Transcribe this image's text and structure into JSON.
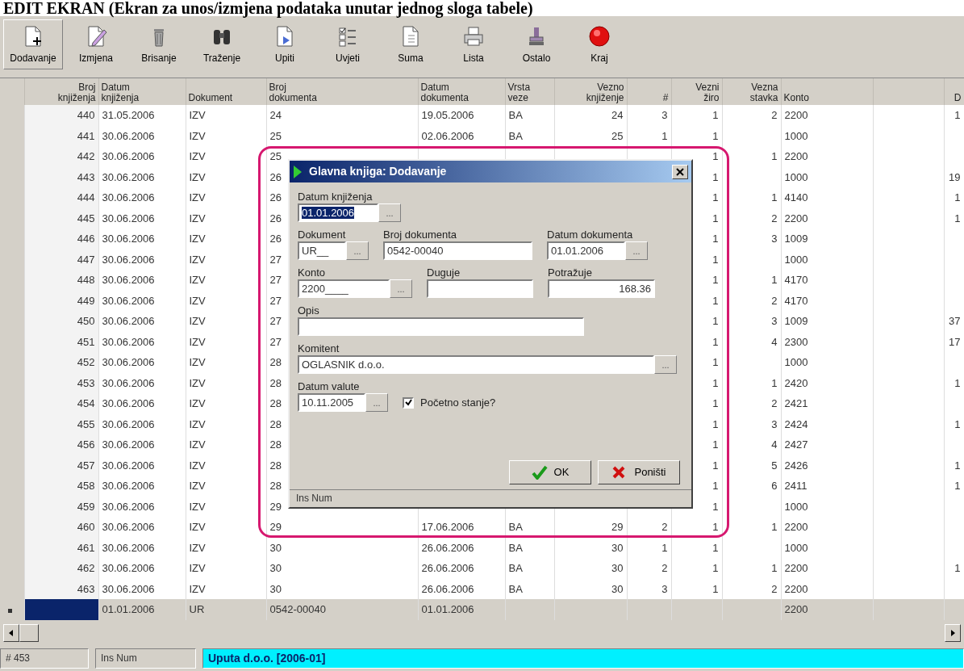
{
  "heading": "EDIT EKRAN (Ekran za unos/izmjena podataka unutar jednog sloga tabele)",
  "toolbar": [
    {
      "label": "Dodavanje",
      "selected": true
    },
    {
      "label": "Izmjena",
      "selected": false
    },
    {
      "label": "Brisanje",
      "selected": false
    },
    {
      "label": "Traženje",
      "selected": false
    },
    {
      "label": "Upiti",
      "selected": false
    },
    {
      "label": "Uvjeti",
      "selected": false
    },
    {
      "label": "Suma",
      "selected": false
    },
    {
      "label": "Lista",
      "selected": false
    },
    {
      "label": "Ostalo",
      "selected": false
    },
    {
      "label": "Kraj",
      "selected": false
    }
  ],
  "grid": {
    "columns": [
      "Broj knjiženja",
      "Datum knjiženja",
      "Dokument",
      "Broj dokumenta",
      "Datum dokumenta",
      "Vrsta veze",
      "Vezno knjiženje",
      "#",
      "Vezni žiro",
      "Vezna stavka",
      "Konto",
      "D"
    ],
    "rows": [
      {
        "selected": false,
        "cells": [
          "440",
          "31.05.2006",
          "IZV",
          "24",
          "19.05.2006",
          "BA",
          "24",
          "3",
          "1",
          "2",
          "2200",
          "1"
        ]
      },
      {
        "selected": false,
        "cells": [
          "441",
          "30.06.2006",
          "IZV",
          "25",
          "02.06.2006",
          "BA",
          "25",
          "1",
          "1",
          null,
          "1000",
          null
        ]
      },
      {
        "selected": false,
        "cells": [
          "442",
          "30.06.2006",
          "IZV",
          "25",
          null,
          null,
          null,
          null,
          "1",
          "1",
          "2200",
          null
        ]
      },
      {
        "selected": false,
        "cells": [
          "443",
          "30.06.2006",
          "IZV",
          "26",
          null,
          null,
          null,
          null,
          "1",
          null,
          "1000",
          "19"
        ]
      },
      {
        "selected": false,
        "cells": [
          "444",
          "30.06.2006",
          "IZV",
          "26",
          null,
          null,
          null,
          null,
          "1",
          "1",
          "4140",
          "1"
        ]
      },
      {
        "selected": false,
        "cells": [
          "445",
          "30.06.2006",
          "IZV",
          "26",
          null,
          null,
          null,
          null,
          "1",
          "2",
          "2200",
          "1"
        ]
      },
      {
        "selected": false,
        "cells": [
          "446",
          "30.06.2006",
          "IZV",
          "26",
          null,
          null,
          null,
          null,
          "1",
          "3",
          "1009",
          null
        ]
      },
      {
        "selected": false,
        "cells": [
          "447",
          "30.06.2006",
          "IZV",
          "27",
          null,
          null,
          null,
          null,
          "1",
          null,
          "1000",
          null
        ]
      },
      {
        "selected": false,
        "cells": [
          "448",
          "30.06.2006",
          "IZV",
          "27",
          null,
          null,
          null,
          null,
          "1",
          "1",
          "4170",
          null
        ]
      },
      {
        "selected": false,
        "cells": [
          "449",
          "30.06.2006",
          "IZV",
          "27",
          null,
          null,
          null,
          null,
          "1",
          "2",
          "4170",
          null
        ]
      },
      {
        "selected": false,
        "cells": [
          "450",
          "30.06.2006",
          "IZV",
          "27",
          null,
          null,
          null,
          null,
          "1",
          "3",
          "1009",
          "37"
        ]
      },
      {
        "selected": false,
        "cells": [
          "451",
          "30.06.2006",
          "IZV",
          "27",
          null,
          null,
          null,
          null,
          "1",
          "4",
          "2300",
          "17"
        ]
      },
      {
        "selected": false,
        "cells": [
          "452",
          "30.06.2006",
          "IZV",
          "28",
          null,
          null,
          null,
          null,
          "1",
          null,
          "1000",
          null
        ]
      },
      {
        "selected": false,
        "cells": [
          "453",
          "30.06.2006",
          "IZV",
          "28",
          null,
          null,
          null,
          null,
          "1",
          "1",
          "2420",
          "1"
        ]
      },
      {
        "selected": false,
        "cells": [
          "454",
          "30.06.2006",
          "IZV",
          "28",
          null,
          null,
          null,
          null,
          "1",
          "2",
          "2421",
          null
        ]
      },
      {
        "selected": false,
        "cells": [
          "455",
          "30.06.2006",
          "IZV",
          "28",
          null,
          null,
          null,
          null,
          "1",
          "3",
          "2424",
          "1"
        ]
      },
      {
        "selected": false,
        "cells": [
          "456",
          "30.06.2006",
          "IZV",
          "28",
          null,
          null,
          null,
          null,
          "1",
          "4",
          "2427",
          null
        ]
      },
      {
        "selected": false,
        "cells": [
          "457",
          "30.06.2006",
          "IZV",
          "28",
          null,
          null,
          null,
          null,
          "1",
          "5",
          "2426",
          "1"
        ]
      },
      {
        "selected": false,
        "cells": [
          "458",
          "30.06.2006",
          "IZV",
          "28",
          null,
          null,
          null,
          null,
          "1",
          "6",
          "2411",
          "1"
        ]
      },
      {
        "selected": false,
        "cells": [
          "459",
          "30.06.2006",
          "IZV",
          "29",
          null,
          null,
          null,
          null,
          "1",
          null,
          "1000",
          null
        ]
      },
      {
        "selected": false,
        "cells": [
          "460",
          "30.06.2006",
          "IZV",
          "29",
          "17.06.2006",
          "BA",
          "29",
          "2",
          "1",
          "1",
          "2200",
          null
        ]
      },
      {
        "selected": false,
        "cells": [
          "461",
          "30.06.2006",
          "IZV",
          "30",
          "26.06.2006",
          "BA",
          "30",
          "1",
          "1",
          null,
          "1000",
          null
        ]
      },
      {
        "selected": false,
        "cells": [
          "462",
          "30.06.2006",
          "IZV",
          "30",
          "26.06.2006",
          "BA",
          "30",
          "2",
          "1",
          "1",
          "2200",
          "1"
        ]
      },
      {
        "selected": false,
        "cells": [
          "463",
          "30.06.2006",
          "IZV",
          "30",
          "26.06.2006",
          "BA",
          "30",
          "3",
          "1",
          "2",
          "2200",
          null
        ]
      },
      {
        "selected": true,
        "cells": [
          null,
          "01.01.2006",
          "UR",
          "0542-00040",
          "01.01.2006",
          null,
          null,
          null,
          null,
          null,
          "2200",
          null
        ]
      }
    ]
  },
  "dialog": {
    "title": "Glavna knjiga: Dodavanje",
    "fields": [
      {
        "label": "Datum knjiženja",
        "value": "01.01.2006",
        "picker": "...",
        "selected": true
      },
      {
        "label": "Dokument",
        "value": "UR__",
        "picker": "...",
        "selected": false
      },
      {
        "label": "Broj dokumenta",
        "value": "0542-00040",
        "selected": false
      },
      {
        "label": "Datum dokumenta",
        "value": "01.01.2006",
        "picker": "...",
        "selected": false
      },
      {
        "label": "Konto",
        "value": "2200____",
        "picker": "...",
        "selected": false
      },
      {
        "label": "Duguje"
      },
      {
        "label": "Potražuje",
        "value": "168.36",
        "selected": false
      },
      {
        "label": "Opis"
      },
      {
        "label": "Komitent",
        "value": "OGLASNIK d.o.o.",
        "picker": "...",
        "selected": false
      },
      {
        "label": "Datum valute",
        "value": "10.11.2005",
        "picker": "...",
        "selected": false
      }
    ],
    "checkbox": {
      "label": "Početno stanje?",
      "checked": true
    },
    "buttons": [
      {
        "label": "OK",
        "kind": "ok"
      },
      {
        "label": "Poništi",
        "kind": "cancel"
      }
    ],
    "status": "Ins Num"
  },
  "status_bar": [
    "# 453",
    "Ins Num",
    "Uputa d.o.o. [2006-01]"
  ]
}
